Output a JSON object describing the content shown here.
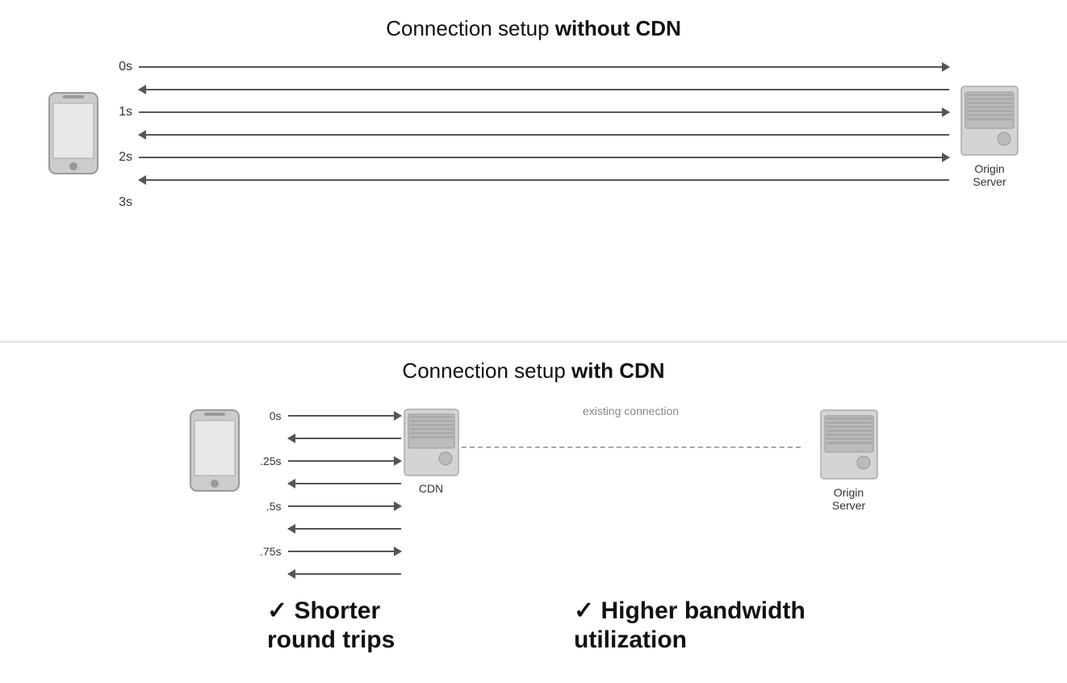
{
  "top_section": {
    "title_normal": "Connection setup ",
    "title_bold": "without CDN",
    "time_labels": [
      "0s",
      "1s",
      "2s",
      "3s"
    ],
    "arrows": [
      {
        "direction": "right"
      },
      {
        "direction": "left"
      },
      {
        "direction": "right"
      },
      {
        "direction": "left"
      },
      {
        "direction": "right"
      },
      {
        "direction": "left"
      }
    ],
    "server_label_line1": "Origin",
    "server_label_line2": "Server"
  },
  "bottom_section": {
    "title_normal": "Connection setup ",
    "title_bold": "with CDN",
    "time_labels": [
      "0s",
      ".25s",
      ".5s",
      ".75s"
    ],
    "cdn_label": "CDN",
    "existing_connection_label": "existing connection",
    "server_label_line1": "Origin",
    "server_label_line2": "Server",
    "benefit1": "✓ Shorter\nround trips",
    "benefit2": "✓ Higher bandwidth\nutilization"
  }
}
